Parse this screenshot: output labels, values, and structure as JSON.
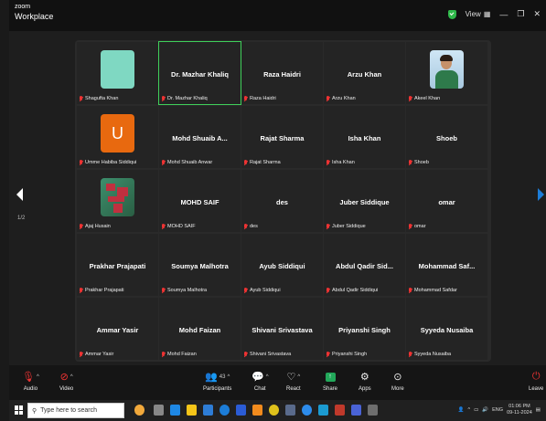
{
  "app": {
    "logo_line1": "zoom",
    "logo_line2": "Workplace",
    "view_label": "View",
    "accent": "#3fd05a"
  },
  "gallery": {
    "page_indicator": "1/2",
    "active_speaker_color": "#3fd05a",
    "tiles": [
      {
        "name": "Shagufta Khan",
        "display": "",
        "avatar": "mint"
      },
      {
        "name": "Dr. Mazhar Khaliq",
        "display": "Dr. Mazhar Khaliq",
        "avatar": ""
      },
      {
        "name": "Raza Haidri",
        "display": "Raza Haidri",
        "avatar": ""
      },
      {
        "name": "Arzu Khan",
        "display": "Arzu Khan",
        "avatar": ""
      },
      {
        "name": "Akeel Khan",
        "display": "",
        "avatar": "photo1"
      },
      {
        "name": "Umme Habiba Siddiqui",
        "display": "",
        "avatar": "letter-u"
      },
      {
        "name": "Mohd Shuaib Anwar",
        "display": "Mohd Shuaib A...",
        "avatar": ""
      },
      {
        "name": "Rajat Sharma",
        "display": "Rajat Sharma",
        "avatar": ""
      },
      {
        "name": "Isha Khan",
        "display": "Isha Khan",
        "avatar": ""
      },
      {
        "name": "Shoeb",
        "display": "Shoeb",
        "avatar": ""
      },
      {
        "name": "Ajaj Husain",
        "display": "",
        "avatar": "photo2"
      },
      {
        "name": "MOHD SAIF",
        "display": "MOHD SAIF",
        "avatar": ""
      },
      {
        "name": "des",
        "display": "des",
        "avatar": ""
      },
      {
        "name": "Juber Siddique",
        "display": "Juber Siddique",
        "avatar": ""
      },
      {
        "name": "omar",
        "display": "omar",
        "avatar": ""
      },
      {
        "name": "Prakhar Prajapati",
        "display": "Prakhar Prajapati",
        "avatar": ""
      },
      {
        "name": "Soumya Malhotra",
        "display": "Soumya Malhotra",
        "avatar": ""
      },
      {
        "name": "Ayub Siddiqui",
        "display": "Ayub Siddiqui",
        "avatar": ""
      },
      {
        "name": "Abdul Qadir Siddiqui",
        "display": "Abdul Qadir Sid...",
        "avatar": ""
      },
      {
        "name": "Mohammad Safdar",
        "display": "Mohammad Saf...",
        "avatar": ""
      },
      {
        "name": "Ammar Yasir",
        "display": "Ammar Yasir",
        "avatar": ""
      },
      {
        "name": "Mohd Faizan",
        "display": "Mohd Faizan",
        "avatar": ""
      },
      {
        "name": "Shivani Srivastava",
        "display": "Shivani Srivastava",
        "avatar": ""
      },
      {
        "name": "Priyanshi Singh",
        "display": "Priyanshi Singh",
        "avatar": ""
      },
      {
        "name": "Syyeda Nusaiba",
        "display": "Syyeda Nusaiba",
        "avatar": ""
      }
    ]
  },
  "toolbar": {
    "audio": "Audio",
    "video": "Video",
    "participants": "Participants",
    "participants_count": "43",
    "chat": "Chat",
    "react": "React",
    "share": "Share",
    "apps": "Apps",
    "more": "More",
    "leave": "Leave"
  },
  "taskbar": {
    "search_placeholder": "Type here to search",
    "language": "ENG",
    "time": "01:06 PM",
    "date": "09-11-2024"
  }
}
